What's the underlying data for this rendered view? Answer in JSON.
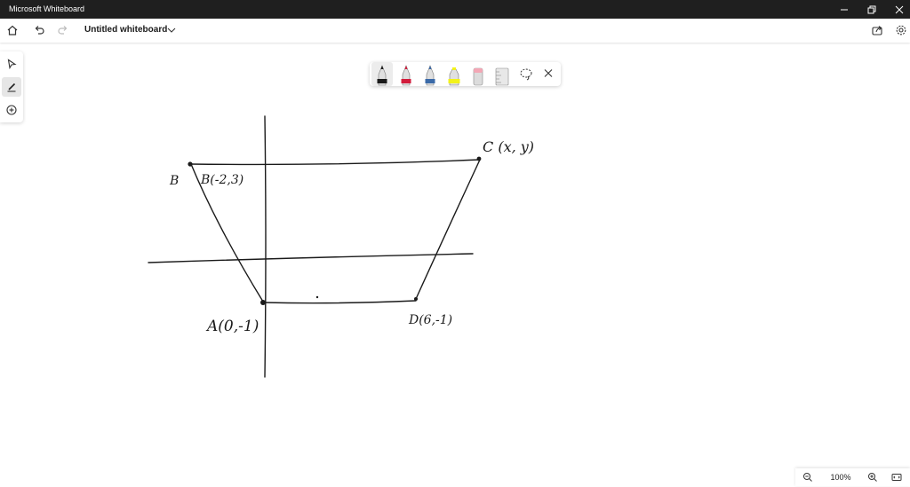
{
  "window": {
    "title": "Microsoft Whiteboard"
  },
  "toolbar": {
    "board_title": "Untitled whiteboard"
  },
  "icons": {
    "home": "home-icon",
    "undo": "undo-icon",
    "redo": "redo-icon",
    "title_menu": "chevron-down-icon",
    "share": "share-icon",
    "settings": "gear-icon",
    "select": "select-arrow-icon",
    "inking": "inking-pen-icon",
    "add": "plus-circle-icon",
    "lasso": "lasso-icon",
    "close": "close-icon",
    "zoom_out": "zoom-out-icon",
    "zoom_in": "zoom-in-icon",
    "fit": "fit-screen-icon"
  },
  "pens": [
    {
      "name": "black-pen",
      "color": "#1a1a1a"
    },
    {
      "name": "red-pen",
      "color": "#d21c3c"
    },
    {
      "name": "blue-pen",
      "color": "#3b6aa8"
    },
    {
      "name": "highlighter",
      "color": "#f2f21a"
    },
    {
      "name": "eraser",
      "color": "#f3a7b5"
    },
    {
      "name": "ruler",
      "color": "#cccccc"
    }
  ],
  "canvas": {
    "labels": {
      "b_short": "B",
      "b_point": "B(-2,3)",
      "c_point": "C (x, y)",
      "a_point": "A(0,-1)",
      "d_point": "D(6,-1)"
    }
  },
  "zoom": {
    "level": "100%"
  }
}
